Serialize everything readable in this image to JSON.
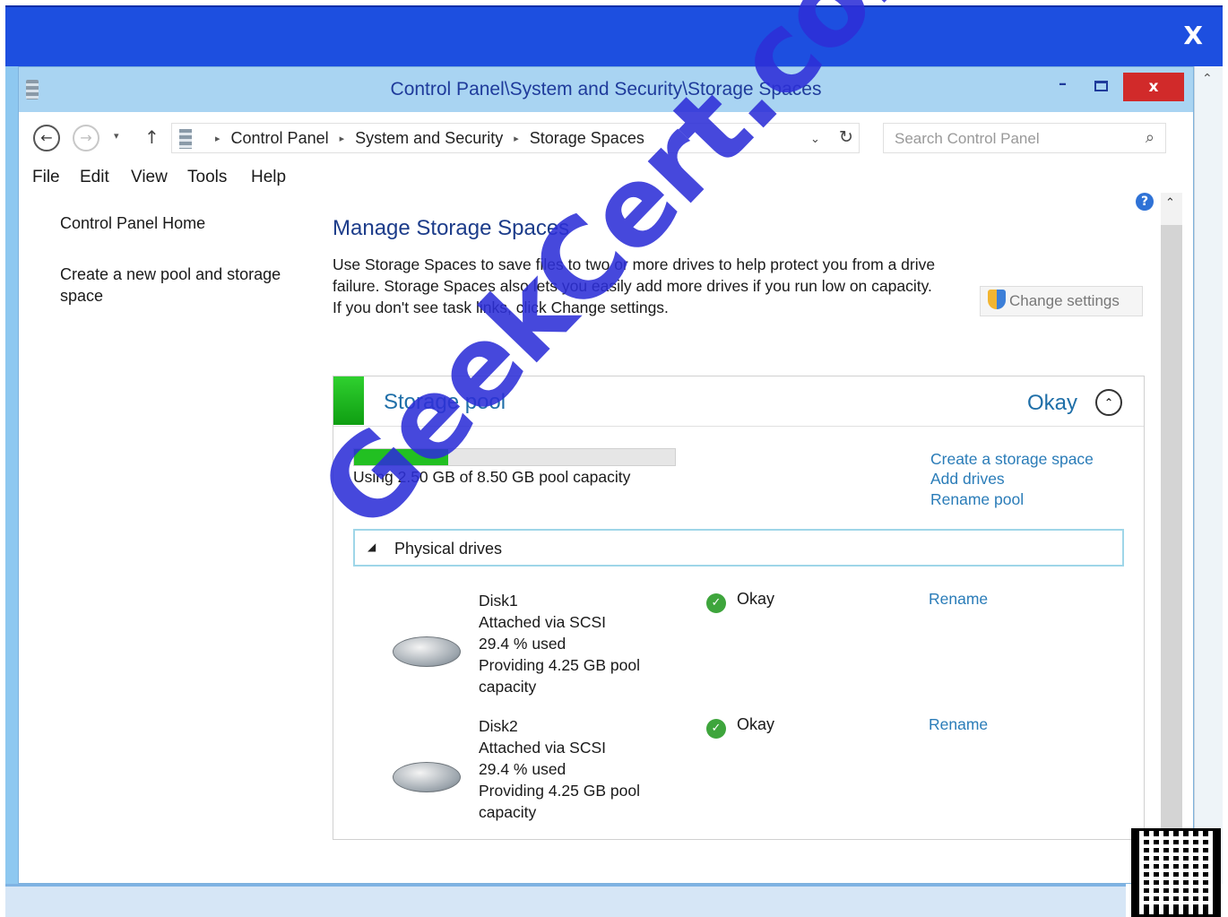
{
  "outer": {
    "close_label": "X"
  },
  "window": {
    "title": "Control Panel\\System and Security\\Storage Spaces",
    "minimize_label": "–",
    "close_label": "x"
  },
  "navbar": {
    "back_glyph": "←",
    "forward_glyph": "→",
    "recent_glyph": "▾",
    "up_glyph": "↑",
    "breadcrumbs": [
      "Control Panel",
      "System and Security",
      "Storage Spaces"
    ],
    "crumb_separator": "▸",
    "dropdown_glyph": "⌄",
    "refresh_glyph": "↻",
    "search_placeholder": "Search Control Panel",
    "search_glyph": "⌕"
  },
  "menu": [
    {
      "label": "File"
    },
    {
      "label": "Edit"
    },
    {
      "label": "View"
    },
    {
      "label": "Tools"
    },
    {
      "label": "Help"
    }
  ],
  "help_glyph": "?",
  "left_pane": {
    "home_link": "Control Panel Home",
    "create_pool_link": "Create a new pool and storage space"
  },
  "main": {
    "title": "Manage Storage Spaces",
    "description": "Use Storage Spaces to save files to two or more drives to help protect you from a drive failure. Storage Spaces also lets you easily add more drives if you run low on capacity. If you don't see task links, click Change settings.",
    "change_settings_label": "Change settings"
  },
  "pool": {
    "title": "Storage pool",
    "status": "Okay",
    "collapse_glyph": "⌃",
    "used_fraction": 0.294,
    "capacity_text": "Using 2.50 GB of 8.50 GB pool capacity",
    "links": [
      "Create a storage space",
      "Add drives",
      "Rename pool"
    ],
    "physical_drives_label": "Physical drives",
    "collapse_triangle": "◢",
    "disks": [
      {
        "name": "Disk1",
        "connection": "Attached via SCSI",
        "used": "29.4 % used",
        "providing": "Providing 4.25 GB pool",
        "providing_cont": "capacity",
        "status": "Okay",
        "check_glyph": "✓",
        "rename_label": "Rename"
      },
      {
        "name": "Disk2",
        "connection": "Attached via SCSI",
        "used": "29.4 % used",
        "providing": "Providing 4.25 GB pool",
        "providing_cont": "capacity",
        "status": "Okay",
        "check_glyph": "✓",
        "rename_label": "Rename"
      }
    ]
  },
  "watermark": "GeekCert.com",
  "colors": {
    "accent_blue": "#1f6fa8",
    "link_blue": "#2a7cb8",
    "status_green": "#22c022",
    "close_red": "#d12a2a",
    "frame_blue": "#1d4fe0"
  }
}
